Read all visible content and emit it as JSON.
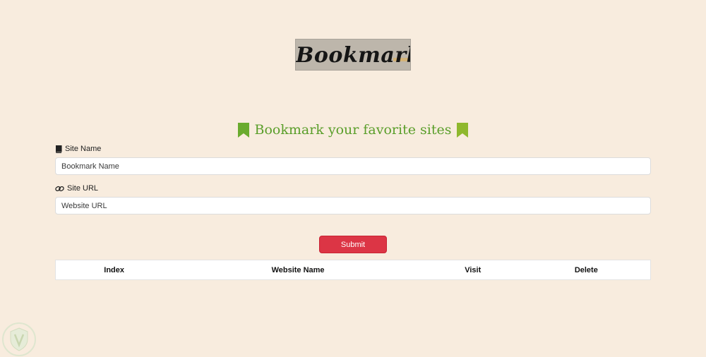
{
  "logo": {
    "text": "Bookmarker"
  },
  "heading": {
    "text": "Bookmark your favorite sites",
    "icon": "bookmark-icon",
    "color": "#5a9e2a"
  },
  "form": {
    "site_name_label": "Site Name",
    "site_name_icon": "book-icon",
    "site_name_placeholder": "Bookmark Name",
    "site_url_label": "Site URL",
    "site_url_icon": "link-icon",
    "site_url_placeholder": "Website URL",
    "submit_label": "Submit",
    "submit_color": "#dc3545"
  },
  "table": {
    "columns": [
      "Index",
      "Website Name",
      "Visit",
      "Delete"
    ],
    "rows": []
  },
  "colors": {
    "background": "#f8ecde"
  }
}
